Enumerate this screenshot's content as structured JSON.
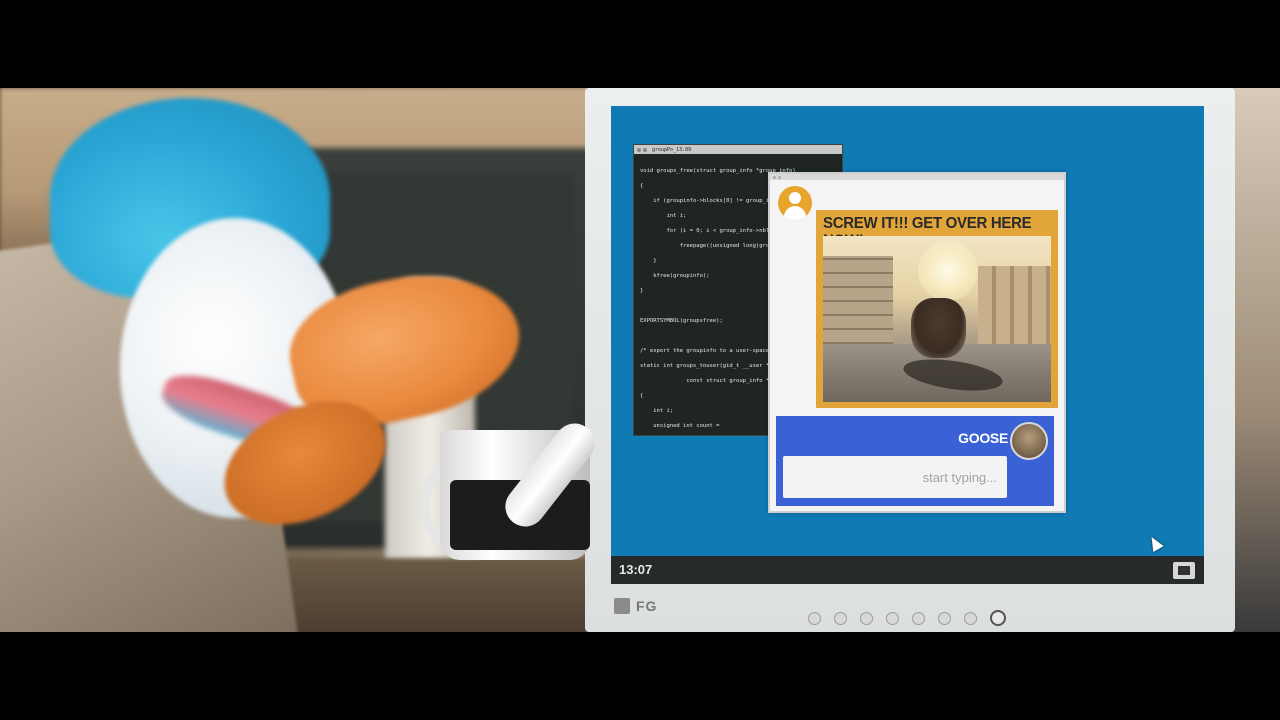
{
  "code_window": {
    "title": "groupPo_13.09",
    "lines": [
      "void groups_free(struct group_info *group_info)",
      "{",
      "    if (groupinfo->blocks[0] != group_info->",
      "        int i;",
      "        for (i = 0; i < group_info->nblocks;",
      "            freepage((unsigned long)groupinf",
      "    }",
      "    kfree(groupinfo);",
      "}",
      "",
      "EXPORTSYMBOL(groupsfree);",
      "",
      "/* export the groupinfo to a user-space arra",
      "static int groups_touser(gid_t __user *groupl",
      "              const struct group_info *group",
      "{",
      "    int i;",
      "    unsigned int count = "
    ]
  },
  "chat": {
    "message_text": "SCREW IT!!! GET OVER HERE NOW!",
    "reply_name": "GOOSE",
    "reply_placeholder": "start typing..."
  },
  "taskbar": {
    "clock": "13:07"
  },
  "monitor": {
    "brand": "FG"
  },
  "colors": {
    "desktop": "#0f7ab4",
    "message_bubble": "#e1a53a",
    "reply_area": "#3a62d6",
    "taskbar": "#262a2b"
  },
  "icons": {
    "sender_avatar": "user-icon",
    "tray": "window-icon",
    "cursor": "mouse-pointer-icon"
  }
}
